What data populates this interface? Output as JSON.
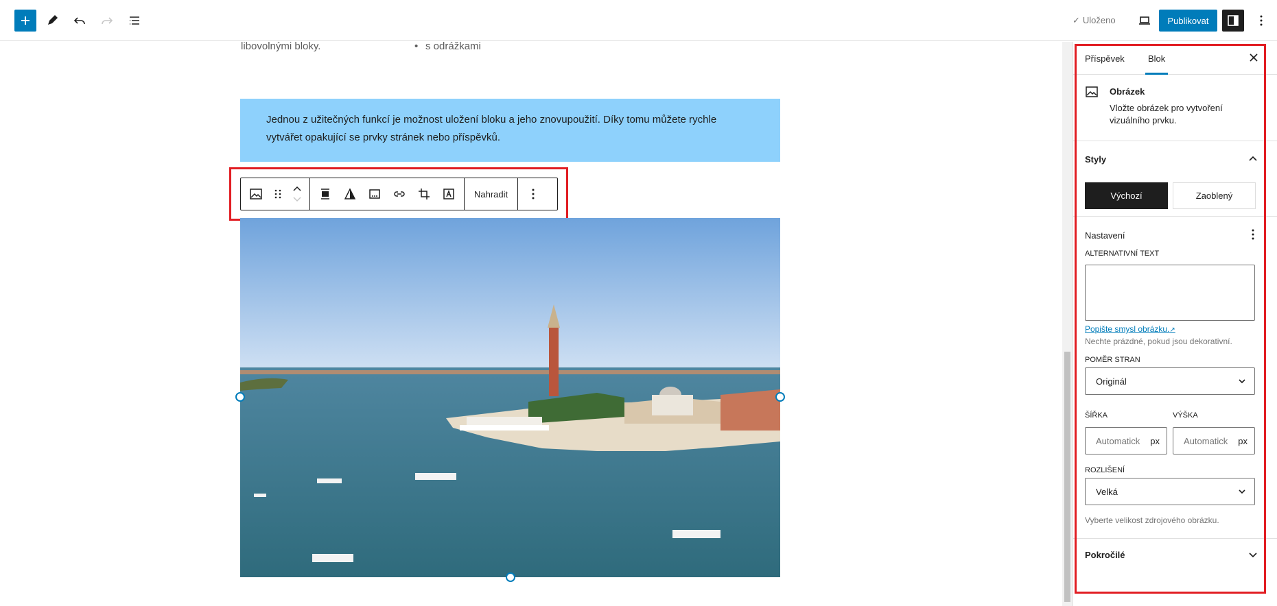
{
  "topbar": {
    "saved_label": "Uloženo",
    "publish_label": "Publikovat"
  },
  "canvas": {
    "prev_left_text": "libovolnými bloky.",
    "prev_right_text": "s odrážkami",
    "callout_text": "Jednou z užitečných funkcí je možnost uložení bloku a jeho znovupoužití. Díky tomu můžete rychle vytvářet opakující se prvky stránek nebo příspěvků.",
    "toolbar": {
      "replace_label": "Nahradit"
    }
  },
  "sidebar": {
    "tabs": [
      {
        "label": "Příspěvek"
      },
      {
        "label": "Blok"
      }
    ],
    "block_card": {
      "title": "Obrázek",
      "description": "Vložte obrázek pro vytvoření vizuálního prvku."
    },
    "styles": {
      "title": "Styly",
      "options": [
        {
          "label": "Výchozí"
        },
        {
          "label": "Zaoblený"
        }
      ]
    },
    "settings": {
      "title": "Nastavení",
      "alt_label": "ALTERNATIVNÍ TEXT",
      "alt_value": "",
      "alt_link": "Popište smysl obrázku.",
      "alt_help": "Nechte prázdné, pokud jsou dekorativní.",
      "aspect_label": "POMĚR STRAN",
      "aspect_value": "Originál",
      "width_label": "ŠÍŘKA",
      "width_placeholder": "Automatick",
      "height_label": "VÝŠKA",
      "height_placeholder": "Automatick",
      "unit": "px",
      "resolution_label": "ROZLIŠENÍ",
      "resolution_value": "Velká",
      "resolution_help": "Vyberte velikost zdrojového obrázku."
    },
    "advanced": {
      "title": "Pokročilé"
    }
  }
}
